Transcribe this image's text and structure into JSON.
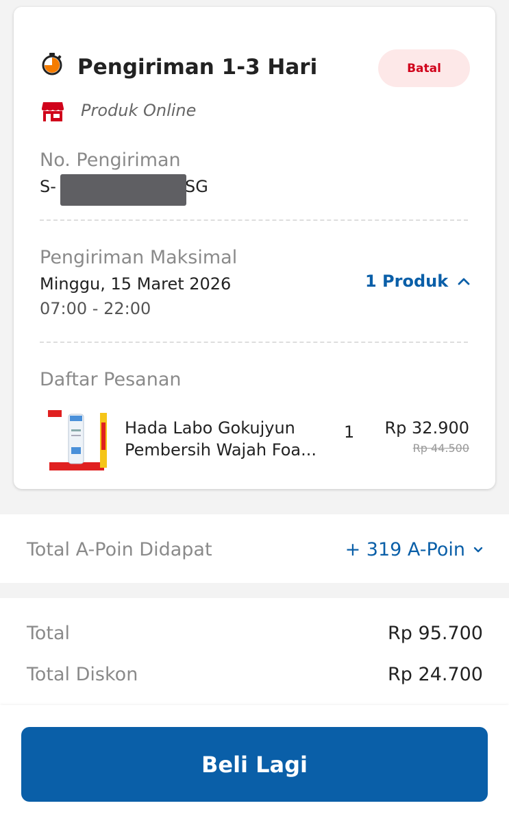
{
  "shipment": {
    "title": "Pengiriman 1-3 Hari",
    "status_badge": "Batal",
    "store_type": "Produk Online",
    "number_label": "No. Pengiriman",
    "number_prefix": "S-",
    "number_suffix": "SG",
    "max_label": "Pengiriman Maksimal",
    "max_date": "Minggu, 15 Maret 2026",
    "max_time": "07:00 - 22:00",
    "product_count": "1 Produk"
  },
  "orders": {
    "label": "Daftar Pesanan",
    "items": [
      {
        "name_line1": "Hada Labo Gokujyun",
        "name_line2": "Pembersih Wajah Foa...",
        "qty": "1",
        "price": "Rp 32.900",
        "old_price": "Rp 44.500"
      }
    ]
  },
  "points": {
    "label": "Total A-Poin Didapat",
    "value": "+ 319 A-Poin"
  },
  "totals": {
    "total_label": "Total",
    "total_value": "Rp 95.700",
    "discount_label": "Total Diskon",
    "discount_value": "Rp 24.700"
  },
  "actions": {
    "buy_again": "Beli Lagi"
  },
  "colors": {
    "accent": "#0a5fa8",
    "cancel_text": "#d0021b",
    "cancel_bg": "#fde8e8",
    "store_icon": "#d0021b",
    "timer_icon": "#f57c00"
  },
  "icons": {
    "timer": "timer-icon",
    "store": "store-icon",
    "expand": "chevron-up-icon",
    "points_expand": "chevron-down-icon"
  }
}
